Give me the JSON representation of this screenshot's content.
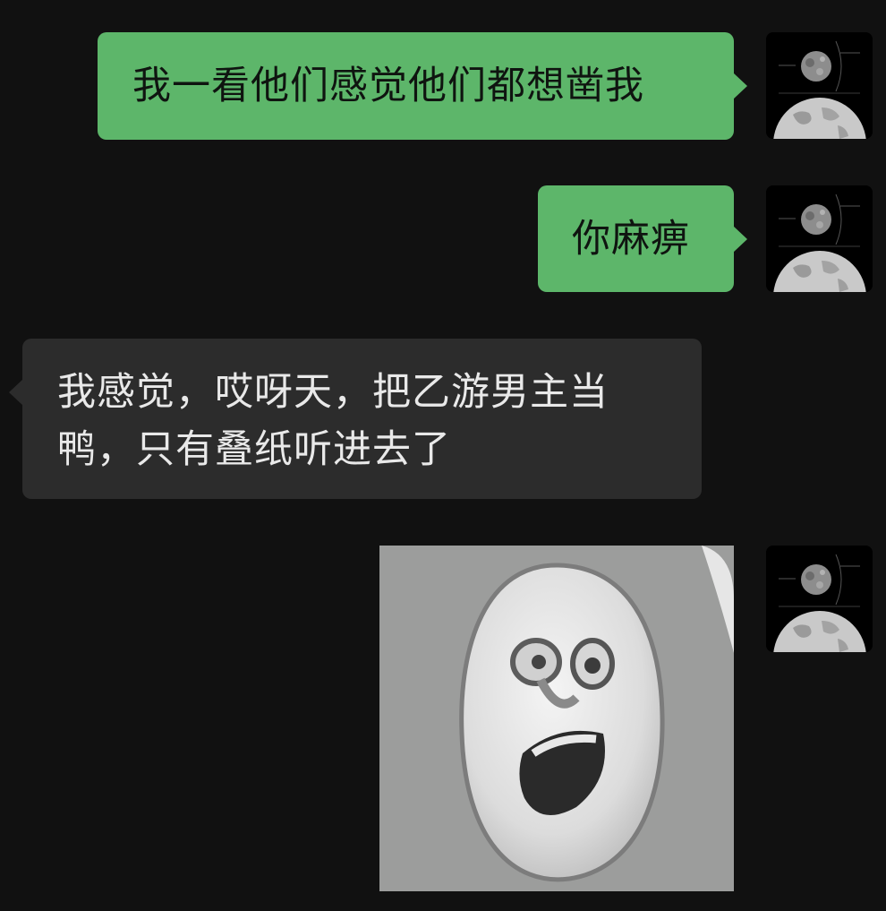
{
  "messages": [
    {
      "direction": "outgoing",
      "type": "text",
      "text": "我一看他们感觉他们都想凿我"
    },
    {
      "direction": "outgoing",
      "type": "text",
      "text": "你麻痹"
    },
    {
      "direction": "incoming",
      "type": "text",
      "text": "我感觉，哎呀天，把乙游男主当鸭，只有叠纸听进去了"
    },
    {
      "direction": "outgoing",
      "type": "image",
      "image": "laughing-ghost-face-sticker"
    }
  ],
  "avatar": {
    "icon": "moon-earth-avatar-icon"
  },
  "colors": {
    "background": "#111111",
    "outgoing_bubble": "#5db66a",
    "incoming_bubble": "#2c2c2c"
  }
}
